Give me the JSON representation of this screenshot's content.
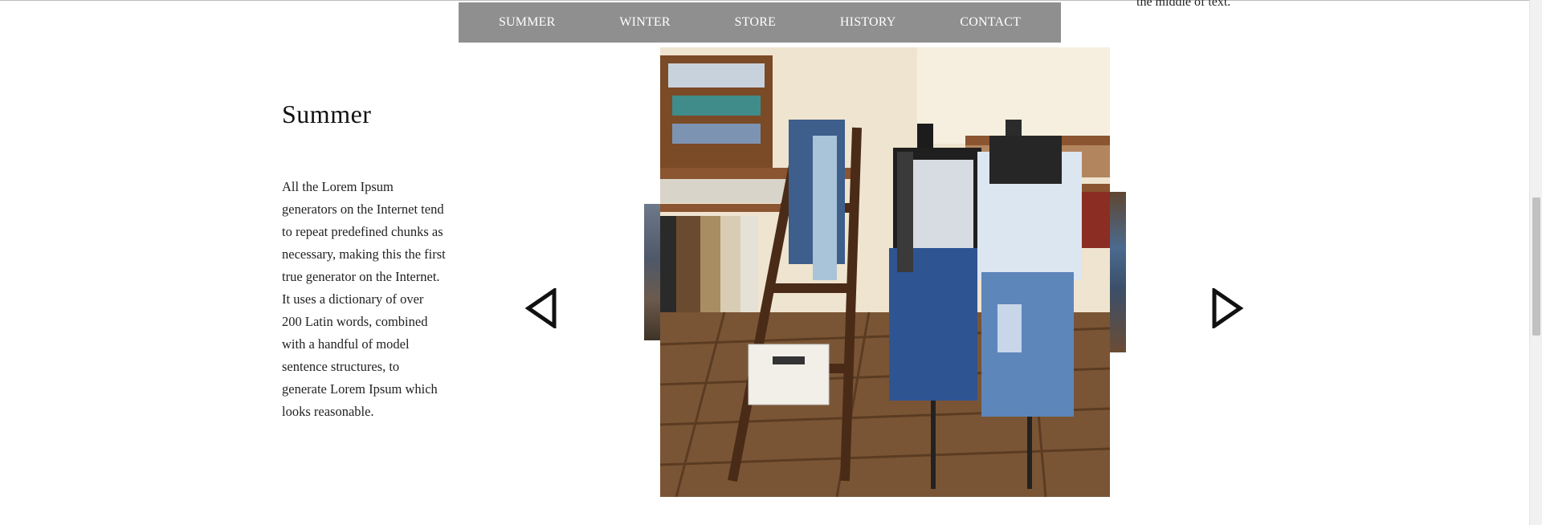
{
  "nav": {
    "items": [
      {
        "label": "SUMMER"
      },
      {
        "label": "WINTER"
      },
      {
        "label": "STORE"
      },
      {
        "label": "HISTORY"
      },
      {
        "label": "CONTACT"
      }
    ]
  },
  "top_right": {
    "text": "the middle of text."
  },
  "section": {
    "title": "Summer",
    "body": "All the Lorem Ipsum generators on the Internet tend to repeat predefined chunks as necessary, making this the first true generator on the Internet. It uses a dictionary of over 200 Latin words, combined with a handful of model sentence structures, to generate Lorem Ipsum which looks reasonable."
  },
  "slider": {
    "prev_icon": "triangle-left-outline-icon",
    "next_icon": "triangle-right-outline-icon"
  },
  "colors": {
    "nav_background": "#8f8f8f",
    "nav_text": "#ffffff",
    "page_background": "#ffffff"
  }
}
